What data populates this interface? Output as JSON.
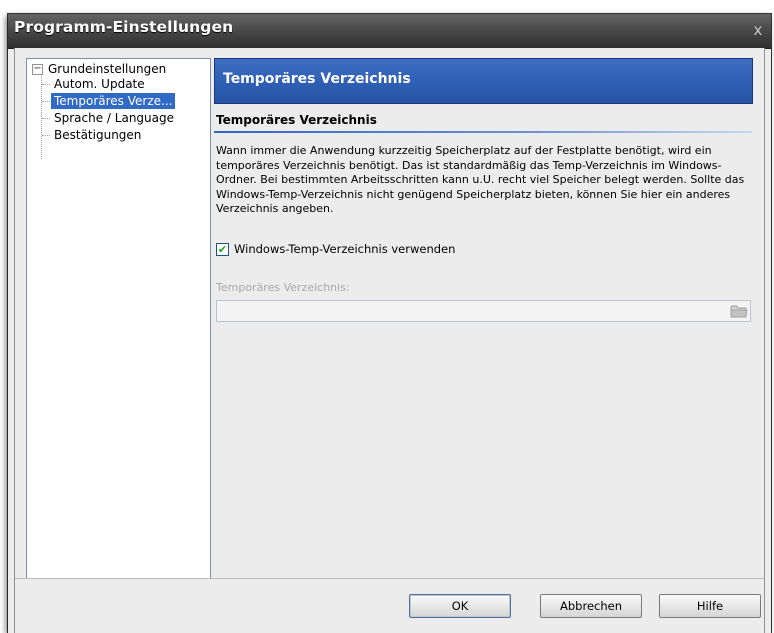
{
  "window": {
    "title": "Programm-Einstellungen",
    "close_glyph": "x"
  },
  "tree": {
    "expander_glyph": "−",
    "root": {
      "label": "Grundeinstellungen"
    },
    "items": [
      {
        "label": "Autom. Update",
        "selected": false
      },
      {
        "label": "Temporäres Verze...",
        "selected": true
      },
      {
        "label": "Sprache / Language",
        "selected": false
      },
      {
        "label": "Bestätigungen",
        "selected": false
      }
    ]
  },
  "content": {
    "header_title": "Temporäres Verzeichnis",
    "section_title": "Temporäres Verzeichnis",
    "description": "Wann immer die Anwendung kurzzeitig Speicherplatz auf der Festplatte benötigt, wird ein temporäres Verzeichnis benötigt. Das ist standardmäßig das Temp-Verzeichnis im Windows-Ordner. Bei bestimmten Arbeitsschritten kann u.U. recht viel Speicher belegt werden. Sollte das Windows-Temp-Verzeichnis nicht genügend Speicherplatz bieten, können Sie hier ein anderes Verzeichnis angeben.",
    "use_windows_temp": {
      "label": "Windows-Temp-Verzeichnis verwenden",
      "checked": true,
      "check_glyph": "✔"
    },
    "temp_dir_field": {
      "label": "Temporäres Verzeichnis:",
      "value": "",
      "enabled": false
    },
    "accent_color": "#2e5fb3"
  },
  "buttons": {
    "ok": "OK",
    "cancel": "Abbrechen",
    "help": "Hilfe"
  }
}
